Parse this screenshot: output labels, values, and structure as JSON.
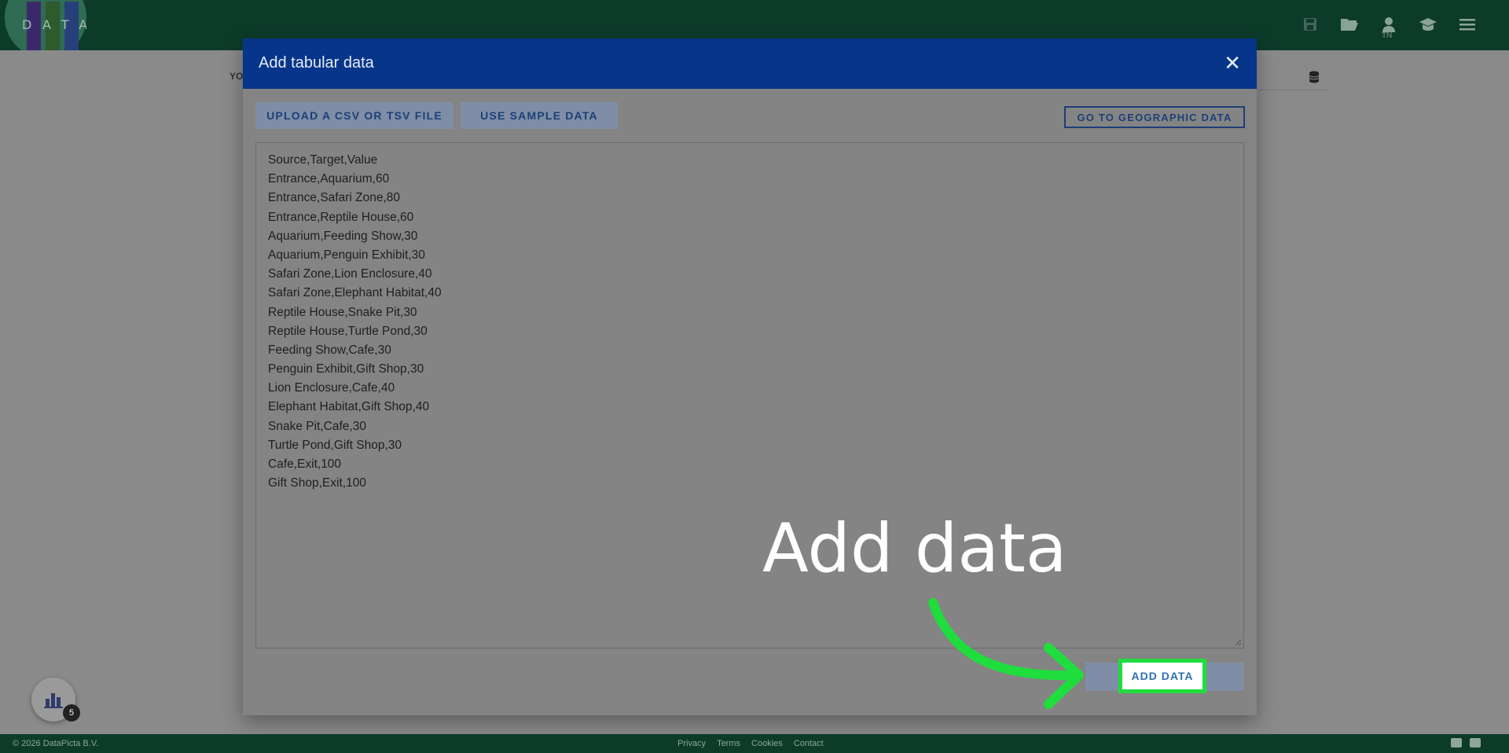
{
  "app": {
    "logo_text": "DATAPICTA",
    "user_initials": "TN",
    "colors": {
      "topbar": "#0d3b2a",
      "modal_header": "#06358a",
      "highlight": "#1fdd3d"
    },
    "icons": [
      "save-icon",
      "folder-open-icon",
      "user-icon",
      "graduation-cap-icon",
      "menu-icon"
    ]
  },
  "background": {
    "stub_text": "YO"
  },
  "modal": {
    "title": "Add tabular data",
    "close_label": "✕",
    "upload_label": "UPLOAD A CSV OR TSV FILE",
    "sample_label": "USE SAMPLE DATA",
    "geo_label": "GO TO GEOGRAPHIC DATA",
    "add_label": "ADD DATA",
    "data_lines": [
      "Source,Target,Value",
      "Entrance,Aquarium,60",
      "Entrance,Safari Zone,80",
      "Entrance,Reptile House,60",
      "Aquarium,Feeding Show,30",
      "Aquarium,Penguin Exhibit,30",
      "Safari Zone,Lion Enclosure,40",
      "Safari Zone,Elephant Habitat,40",
      "Reptile House,Snake Pit,30",
      "Reptile House,Turtle Pond,30",
      "Feeding Show,Cafe,30",
      "Penguin Exhibit,Gift Shop,30",
      "Lion Enclosure,Cafe,40",
      "Elephant Habitat,Gift Shop,40",
      "Snake Pit,Cafe,30",
      "Turtle Pond,Gift Shop,30",
      "Cafe,Exit,100",
      "Gift Shop,Exit,100"
    ]
  },
  "annotation": {
    "text": "Add data"
  },
  "fab": {
    "count": "5"
  },
  "footer": {
    "copyright": "© 2026 DataPicta B.V.",
    "links": [
      "Privacy",
      "Terms",
      "Cookies",
      "Contact"
    ]
  }
}
